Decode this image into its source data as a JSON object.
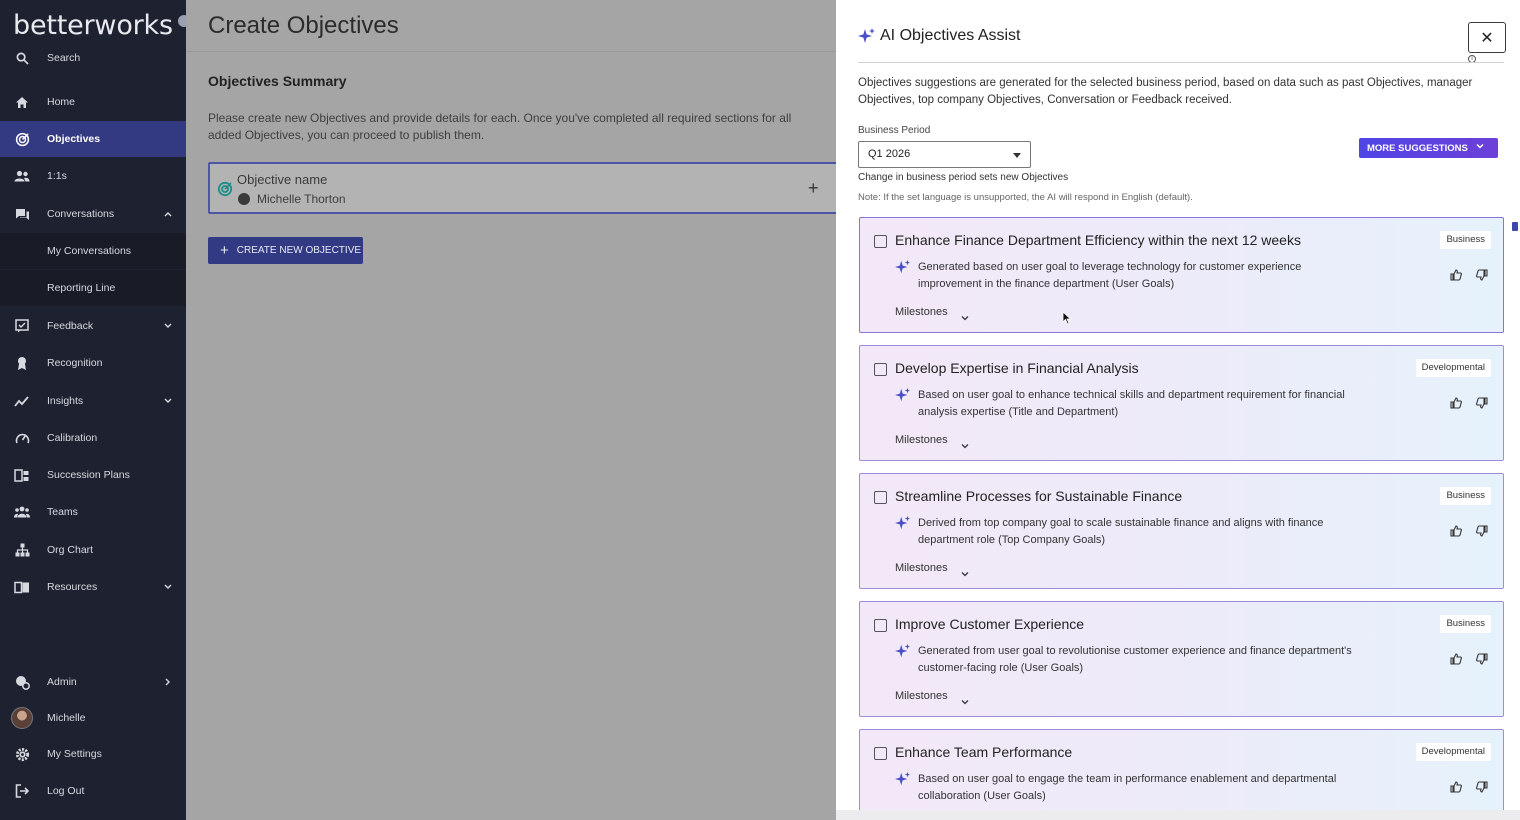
{
  "app": {
    "logo": "betterworks"
  },
  "sidebar": {
    "items": [
      {
        "label": "Search",
        "icon": "search-icon"
      },
      {
        "label": "Home",
        "icon": "home-icon"
      },
      {
        "label": "Objectives",
        "icon": "objectives-icon",
        "active": true
      },
      {
        "label": "1:1s",
        "icon": "people-icon"
      },
      {
        "label": "Conversations",
        "icon": "conversations-icon",
        "expanded": true
      },
      {
        "label": "My Conversations",
        "sub": true
      },
      {
        "label": "Reporting Line",
        "sub": true
      },
      {
        "label": "Feedback",
        "icon": "feedback-icon"
      },
      {
        "label": "Recognition",
        "icon": "recognition-icon"
      },
      {
        "label": "Insights",
        "icon": "insights-icon"
      },
      {
        "label": "Calibration",
        "icon": "calibration-icon"
      },
      {
        "label": "Succession Plans",
        "icon": "succession-icon"
      },
      {
        "label": "Teams",
        "icon": "teams-icon"
      },
      {
        "label": "Org Chart",
        "icon": "org-chart-icon"
      },
      {
        "label": "Resources",
        "icon": "resources-icon"
      },
      {
        "label": "Admin",
        "icon": "admin-icon"
      },
      {
        "label": "Michelle",
        "icon": "avatar"
      },
      {
        "label": "My Settings",
        "icon": "gear-icon"
      },
      {
        "label": "Log Out",
        "icon": "logout-icon"
      }
    ]
  },
  "main": {
    "title": "Create Objectives",
    "summary_title": "Objectives Summary",
    "summary_desc": "Please create new Objectives and provide details for each. Once you've completed all required sections for all added Objectives, you can proceed to publish them.",
    "objective": {
      "name_placeholder": "Objective name",
      "owner": "Michelle Thorton"
    },
    "create_button": "CREATE NEW OBJECTIVE"
  },
  "panel": {
    "title": "AI Objectives Assist",
    "intro": "Objectives suggestions are generated for the selected business period, based on data such as past Objectives, manager Objectives, top company Objectives, Conversation or Feedback received.",
    "business_period_label": "Business Period",
    "business_period_value": "Q1 2026",
    "business_period_hint": "Change in business period sets new Objectives",
    "language_note": "Note: If the set language is unsupported, the AI will respond in English (default).",
    "more_suggestions": "MORE SUGGESTIONS",
    "milestones_label": "Milestones",
    "suggestions": [
      {
        "title": "Enhance Finance Department Efficiency within the next 12 weeks",
        "tag": "Business",
        "reason": "Generated based on user goal to leverage technology for customer experience improvement in the finance department (User Goals)"
      },
      {
        "title": "Develop Expertise in Financial Analysis",
        "tag": "Developmental",
        "reason": "Based on user goal to enhance technical skills and department requirement for financial analysis expertise (Title and Department)"
      },
      {
        "title": "Streamline Processes for Sustainable Finance",
        "tag": "Business",
        "reason": "Derived from top company goal to scale sustainable finance and aligns with finance department role (Top Company Goals)"
      },
      {
        "title": "Improve Customer Experience",
        "tag": "Business",
        "reason": "Generated from user goal to revolutionise customer experience and finance department's customer-facing role (User Goals)"
      },
      {
        "title": "Enhance Team Performance",
        "tag": "Developmental",
        "reason": "Based on user goal to engage the team in performance enablement and departmental collaboration (User Goals)"
      }
    ]
  }
}
